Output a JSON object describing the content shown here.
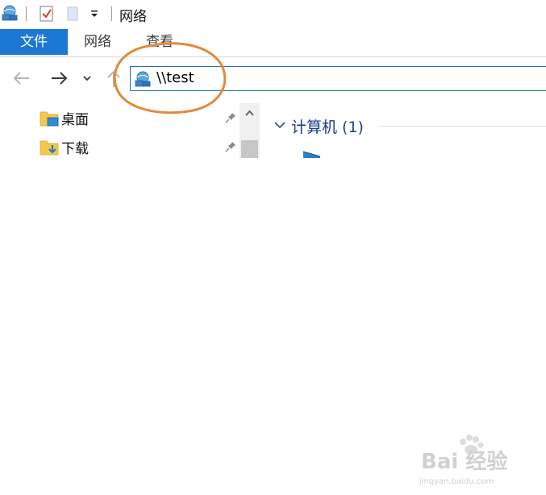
{
  "window": {
    "title": "网络"
  },
  "ribbon": {
    "tabs": [
      {
        "label": "文件",
        "active": true
      },
      {
        "label": "网络"
      },
      {
        "label": "查看"
      }
    ]
  },
  "address_bar": {
    "value": "\\\\test",
    "icon": "network-icon"
  },
  "nav_pane": {
    "items": [
      {
        "label": "桌面",
        "icon": "desktop-folder-icon",
        "pinned": true
      },
      {
        "label": "下载",
        "icon": "downloads-folder-icon",
        "pinned": true
      }
    ]
  },
  "content": {
    "group_title": "计算机 (1)",
    "item_icon": "computer-icon"
  },
  "watermark": {
    "brand": "Bai 经验",
    "url": "jingyan.baidu.com"
  },
  "colors": {
    "accent": "#1c78d2",
    "group_title": "#1e3a8a",
    "annotation": "#e08a3c"
  }
}
